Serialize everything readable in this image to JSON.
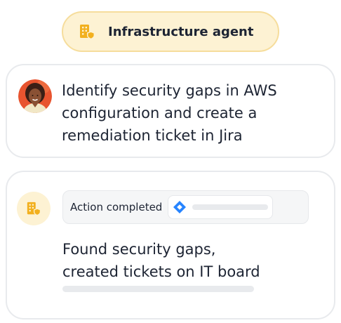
{
  "agent": {
    "label": "Infrastructure agent",
    "icon": "building-shield-icon",
    "accent_color": "#f2b01e",
    "pill_background": "#fdf2d3"
  },
  "prompt": {
    "avatar": "user-avatar",
    "text": "Identify security gaps in AWS\nconfiguration and create a\nremediation ticket in Jira"
  },
  "response": {
    "agent_icon": "building-shield-icon",
    "action": {
      "label": "Action completed",
      "app_icon": "jira-icon",
      "app_color": "#2684ff"
    },
    "text": "Found security gaps,\ncreated tickets on IT board"
  }
}
